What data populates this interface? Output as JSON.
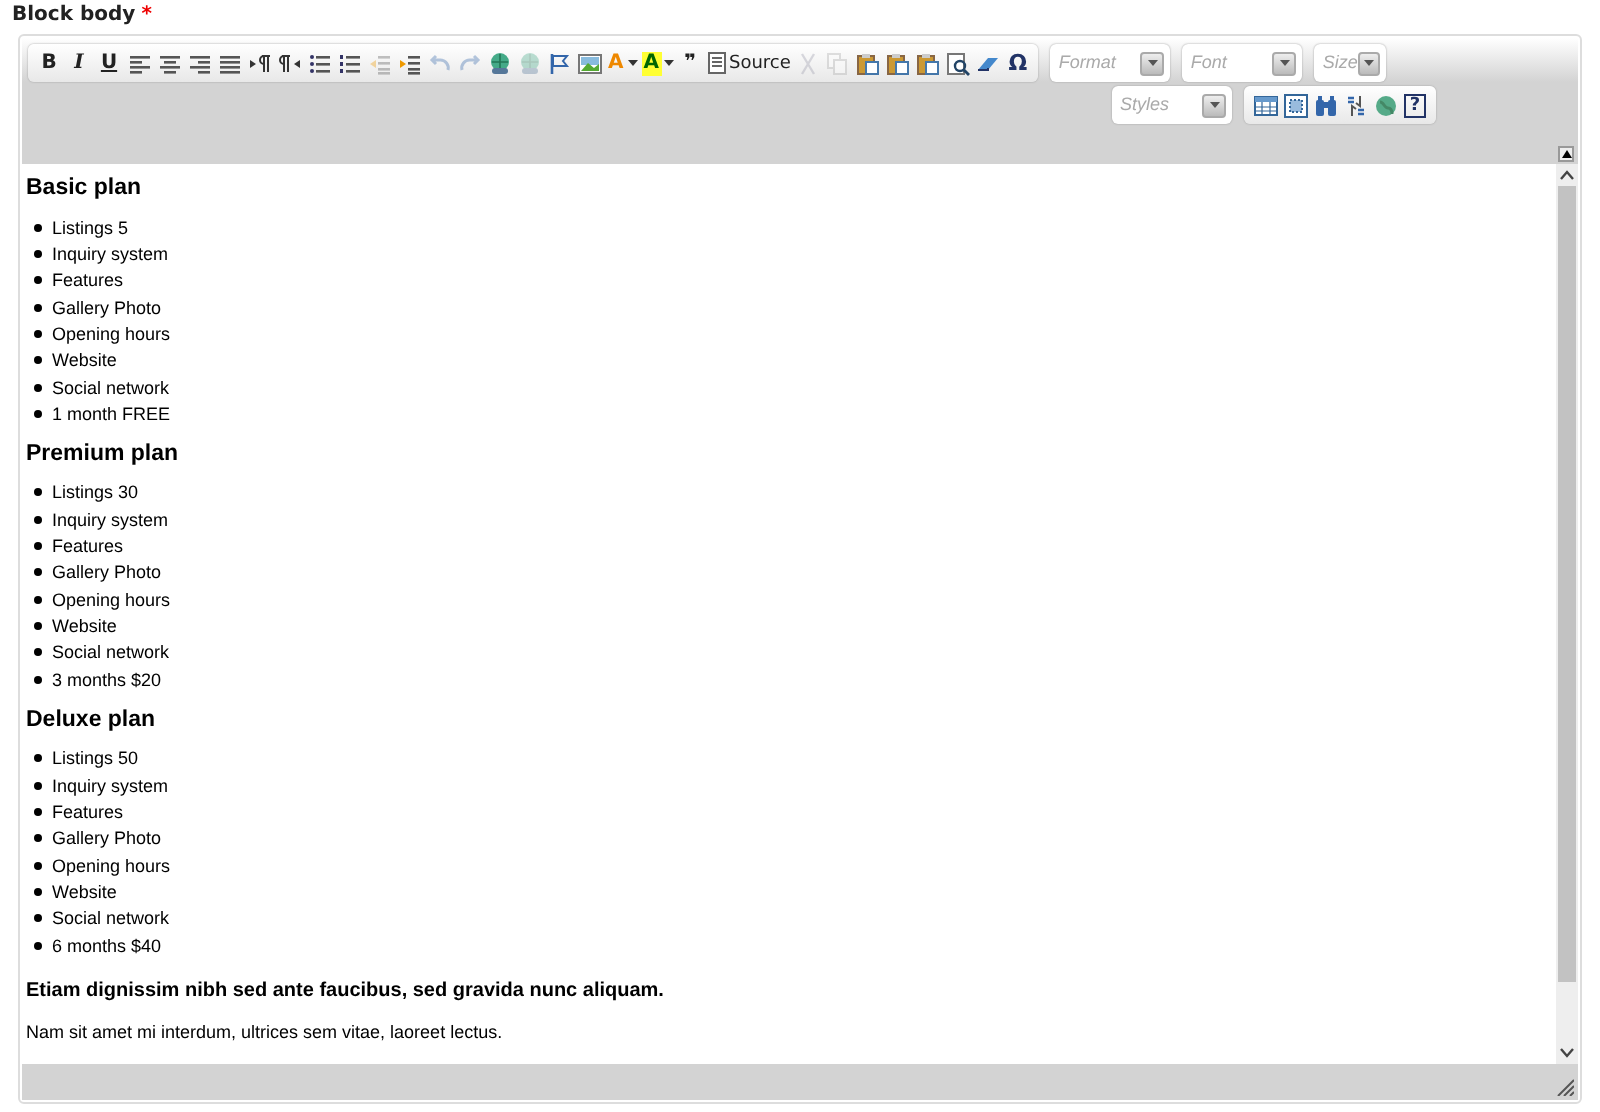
{
  "field": {
    "label": "Block body",
    "required_mark": "*"
  },
  "toolbar": {
    "row_1": [
      {
        "kind": "bold",
        "label": "B",
        "disabled": false
      },
      {
        "kind": "italic",
        "label": "I",
        "disabled": false
      },
      {
        "kind": "underline",
        "label": "U",
        "disabled": false
      },
      {
        "kind": "align-left",
        "disabled": false
      },
      {
        "kind": "align-center",
        "disabled": false
      },
      {
        "kind": "align-right",
        "disabled": false
      },
      {
        "kind": "align-justify",
        "disabled": false
      },
      {
        "kind": "ltr",
        "disabled": false
      },
      {
        "kind": "rtl",
        "disabled": false
      },
      {
        "kind": "bullets",
        "disabled": false
      },
      {
        "kind": "numbers",
        "disabled": false
      },
      {
        "kind": "outdent",
        "disabled": true
      },
      {
        "kind": "indent",
        "disabled": false
      },
      {
        "kind": "undo",
        "disabled": true
      },
      {
        "kind": "redo",
        "disabled": true
      },
      {
        "kind": "link",
        "disabled": false
      },
      {
        "kind": "link",
        "disabled": true
      },
      {
        "kind": "flag",
        "disabled": false
      },
      {
        "kind": "image",
        "disabled": false
      },
      {
        "kind": "text-color",
        "label": "A",
        "disabled": false
      },
      {
        "kind": "bg-color",
        "label": "A",
        "disabled": false
      },
      {
        "kind": "quote",
        "label": "❞",
        "disabled": false
      },
      {
        "kind": "source",
        "label": "Source",
        "disabled": false
      },
      {
        "kind": "cut",
        "disabled": true
      },
      {
        "kind": "copy",
        "disabled": true
      },
      {
        "kind": "paste",
        "disabled": false
      },
      {
        "kind": "paste",
        "disabled": false
      },
      {
        "kind": "paste",
        "disabled": false
      },
      {
        "kind": "find",
        "disabled": false
      },
      {
        "kind": "eraser",
        "disabled": false
      },
      {
        "kind": "omega",
        "label": "Ω",
        "disabled": false
      }
    ],
    "combos_1": [
      {
        "kind": "wide",
        "placeholder": "Format"
      },
      {
        "kind": "wide",
        "placeholder": "Font"
      },
      {
        "kind": "narrow",
        "placeholder": "Size"
      }
    ],
    "combos_2": [
      {
        "kind": "wide",
        "placeholder": "Styles"
      }
    ],
    "row_2": [
      {
        "kind": "table",
        "disabled": false
      },
      {
        "kind": "select-all",
        "disabled": false
      },
      {
        "kind": "binoculars",
        "disabled": false
      },
      {
        "kind": "replace",
        "disabled": false
      },
      {
        "kind": "globe",
        "disabled": false
      },
      {
        "kind": "help",
        "label": "?",
        "disabled": false
      }
    ]
  },
  "content": [
    {
      "kind": "heading",
      "text": "Basic plan"
    },
    {
      "kind": "list",
      "items": [
        "Listings 5",
        "Inquiry system",
        "Features",
        "Gallery Photo",
        "Opening hours",
        "Website",
        "Social network",
        "1 month FREE"
      ]
    },
    {
      "kind": "heading",
      "text": "Premium plan"
    },
    {
      "kind": "list",
      "items": [
        "Listings 30",
        "Inquiry system",
        "Features",
        "Gallery Photo",
        "Opening hours",
        "Website",
        "Social network",
        "3 months $20"
      ]
    },
    {
      "kind": "heading",
      "text": "Deluxe plan"
    },
    {
      "kind": "list",
      "items": [
        "Listings 50",
        "Inquiry system",
        "Features",
        "Gallery Photo",
        "Opening hours",
        "Website",
        "Social network",
        "6 months $40"
      ]
    },
    {
      "kind": "strong",
      "text": "Etiam dignissim nibh sed ante faucibus, sed gravida nunc aliquam."
    },
    {
      "kind": "paragraph",
      "text": "Nam sit amet mi interdum, ultrices sem vitae, laoreet lectus."
    }
  ]
}
